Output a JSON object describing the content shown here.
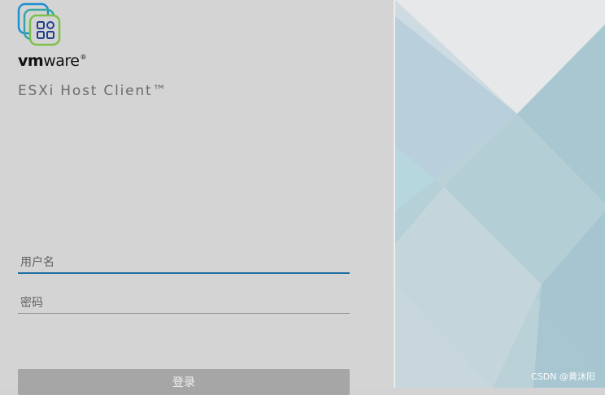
{
  "brand": {
    "logo_icon": "vmware-esxi-icon",
    "wordmark_bold": "vm",
    "wordmark_rest": "ware",
    "wordmark_mark": "®",
    "product_name": "ESXi Host Client™"
  },
  "form": {
    "username_placeholder": "用户名",
    "password_placeholder": "密码",
    "login_label": "登录"
  },
  "watermark": "CSDN @黄沐阳",
  "colors": {
    "accent": "#1f6fa4",
    "button": "#a6a6a6",
    "panel": "#d4d4d4"
  }
}
